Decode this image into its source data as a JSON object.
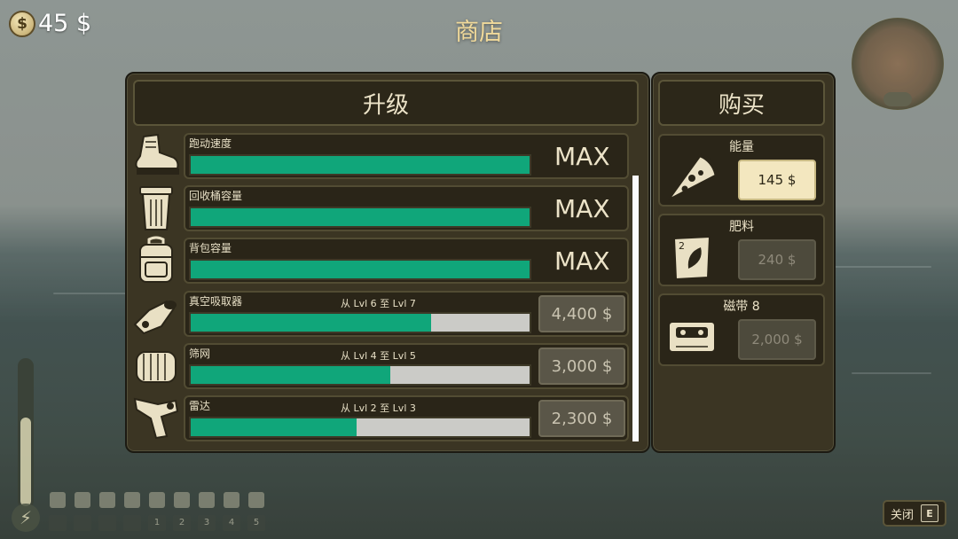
{
  "hud": {
    "money": "45 $",
    "coin_symbol": "$",
    "shop_title": "商店",
    "compass_badge": "",
    "close_label": "关闭",
    "close_key": "E"
  },
  "upgrades": {
    "title": "升级",
    "rows": [
      {
        "label": "跑动速度",
        "level_text": "",
        "progress": 1.0,
        "status": "MAX",
        "icon": "boot-icon"
      },
      {
        "label": "回收桶容量",
        "level_text": "",
        "progress": 1.0,
        "status": "MAX",
        "icon": "trash-bin-icon"
      },
      {
        "label": "背包容量",
        "level_text": "",
        "progress": 1.0,
        "status": "MAX",
        "icon": "backpack-icon"
      },
      {
        "label": "真空吸取器",
        "level_text": "从 Lvl 6 至 Lvl 7",
        "progress": 0.71,
        "price": "4,400 $",
        "icon": "vacuum-icon"
      },
      {
        "label": "筛网",
        "level_text": "从 Lvl 4 至 Lvl 5",
        "progress": 0.59,
        "price": "3,000 $",
        "icon": "sieve-roller-icon"
      },
      {
        "label": "雷达",
        "level_text": "从 Lvl 2 至 Lvl 3",
        "progress": 0.49,
        "price": "2,300 $",
        "icon": "radar-gun-icon"
      }
    ]
  },
  "buy": {
    "title": "购买",
    "items": [
      {
        "label": "能量",
        "price": "145 $",
        "enabled": true,
        "icon": "pizza-slice-icon"
      },
      {
        "label": "肥料",
        "price": "240 $",
        "enabled": false,
        "icon": "fertilizer-bag-icon",
        "badge": "2"
      },
      {
        "label": "磁带 8",
        "price": "2,000 $",
        "enabled": false,
        "icon": "cassette-tape-icon"
      }
    ]
  },
  "hotbar": {
    "slot_keys": [
      "",
      "",
      "",
      "",
      "1",
      "2",
      "3",
      "4",
      "5"
    ]
  },
  "colors": {
    "panel": "#3b3523",
    "progress_fill": "#10a67a",
    "accent_title": "#f0d99a"
  }
}
